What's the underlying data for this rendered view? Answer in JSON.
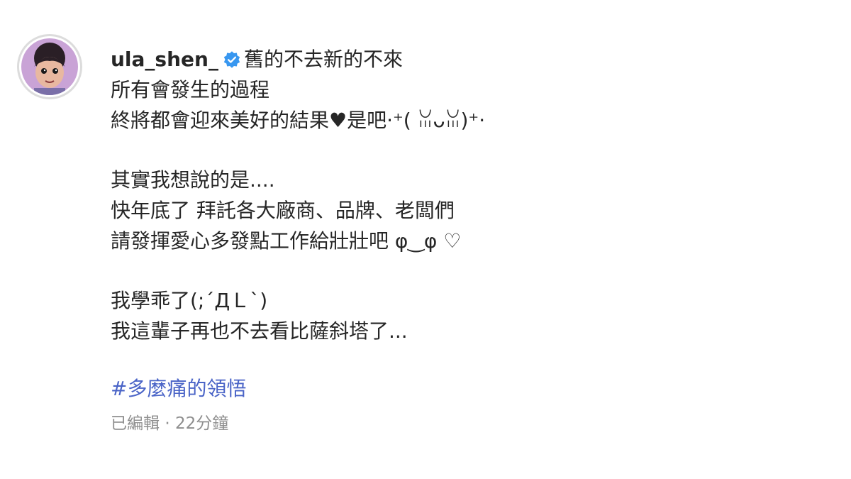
{
  "user": {
    "username": "ula_shen_",
    "verified_icon": "verified-badge-icon",
    "verified_color": "#3897f0"
  },
  "caption": {
    "line1": "舊的不去新的不來",
    "line2": "所有會發生的過程",
    "line3": "終將都會迎來美好的結果♥是吧·⁺( ꈍᴗꈍ)⁺·",
    "line4": "其實我想說的是....",
    "line5": "快年底了 拜託各大廠商、品牌、老闆們",
    "line6": "請發揮愛心多發點工作給壯壯吧  φ‿φ ♡",
    "line7": "我學乖了(;´ДＬ`)",
    "line8": "我這輩子再也不去看比薩斜塔了..."
  },
  "hashtag": "#多麼痛的領悟",
  "meta": {
    "edited": "已編輯",
    "separator": "·",
    "time": "22分鐘"
  },
  "colors": {
    "text": "#262626",
    "hashtag": "#4a64c7",
    "meta": "#8e8e8e"
  }
}
